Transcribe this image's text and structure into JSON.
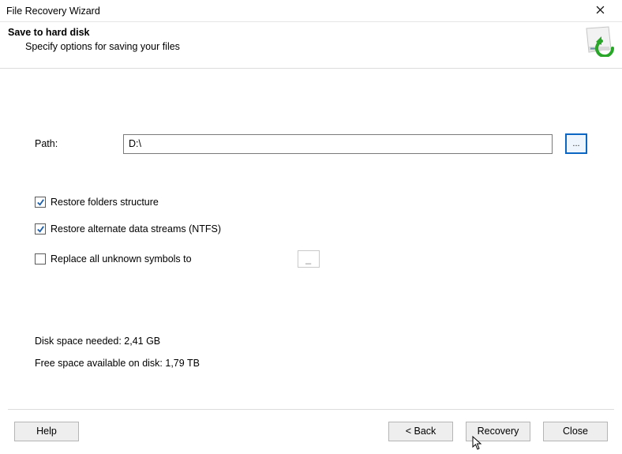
{
  "titlebar": {
    "title": "File Recovery Wizard"
  },
  "header": {
    "title": "Save to hard disk",
    "subtitle": "Specify options for saving your files"
  },
  "path": {
    "label": "Path:",
    "value": "D:\\",
    "browse_label": "..."
  },
  "options": {
    "restore_folders_checked": true,
    "restore_folders_label": "Restore folders structure",
    "restore_ads_checked": true,
    "restore_ads_label": "Restore alternate data streams (NTFS)",
    "replace_symbols_checked": false,
    "replace_symbols_label": "Replace all unknown symbols to",
    "replace_symbols_value": "_"
  },
  "space": {
    "needed_label": "Disk space needed: 2,41 GB",
    "free_label": "Free space available on disk: 1,79 TB"
  },
  "footer": {
    "help_label": "Help",
    "back_label": "< Back",
    "recovery_label": "Recovery",
    "close_label": "Close"
  }
}
